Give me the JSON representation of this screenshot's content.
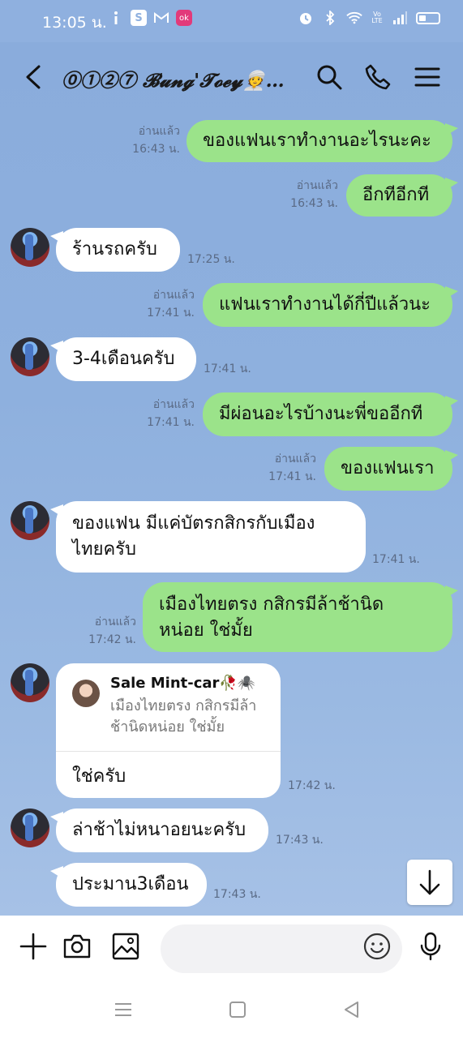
{
  "status_bar": {
    "time": "13:05 น.",
    "app_icons": [
      "info-icon",
      "s-icon",
      "gmail-icon",
      "pink-app-icon"
    ],
    "system_icons": [
      "alarm-icon",
      "bluetooth-icon",
      "wifi-icon",
      "volte-icon",
      "signal-icon",
      "battery-icon"
    ],
    "s_label": "S",
    "pink_label": "ok",
    "volte_label": "Vo LTE",
    "battery_level": 0.35
  },
  "header": {
    "title": "⓪①②⑦ 𝓑𝓾𝓷𝓰'𝓣𝓸𝓮𝔂👳…"
  },
  "messages": [
    {
      "id": "m1",
      "side": "me",
      "text": "ของแฟนเราทำงานอะไรนะคะ",
      "read": "อ่านแล้ว",
      "time": "16:43 น."
    },
    {
      "id": "m2",
      "side": "me",
      "text": "อีกทีอีกที",
      "read": "อ่านแล้ว",
      "time": "16:43 น."
    },
    {
      "id": "m3",
      "side": "them",
      "text": "ร้านรถครับ",
      "time": "17:25 น."
    },
    {
      "id": "m4",
      "side": "me",
      "text": "แฟนเราทำงานได้กี่ปีแล้วนะ",
      "read": "อ่านแล้ว",
      "time": "17:41 น."
    },
    {
      "id": "m5",
      "side": "them",
      "text": "3-4เดือนครับ",
      "time": "17:41 น."
    },
    {
      "id": "m6",
      "side": "me",
      "text": "มีผ่อนอะไรบ้างนะพี่ขออีกที",
      "read": "อ่านแล้ว",
      "time": "17:41 น."
    },
    {
      "id": "m7",
      "side": "me",
      "text": "ของแฟนเรา",
      "read": "อ่านแล้ว",
      "time": "17:41 น."
    },
    {
      "id": "m8",
      "side": "them",
      "line1": "ของแฟน มีแค่บัตรกสิกรกับเมือง",
      "line2": "ไทยครับ",
      "time": "17:41 น."
    },
    {
      "id": "m9",
      "side": "me",
      "line1": "เมืองไทยตรง กสิกรมีล้าช้านิด",
      "line2": "หน่อย ใช่มั้ย",
      "read": "อ่านแล้ว",
      "time": "17:42 น."
    },
    {
      "id": "m10",
      "side": "them",
      "reply_to_name": "Sale Mint-car🥀🕷️",
      "reply_to_line1": "เมืองไทยตรง กสิกรมีล้า",
      "reply_to_line2": "ช้านิดหน่อย ใช่มั้ย",
      "text": "ใช่ครับ",
      "time": "17:42 น."
    },
    {
      "id": "m11",
      "side": "them",
      "text": "ล่าช้าไม่หนาอยนะครับ",
      "time": "17:43 น."
    },
    {
      "id": "m12",
      "side": "them",
      "text": "ประมาน3เดือน",
      "time": "17:43 น."
    }
  ],
  "input": {
    "placeholder": ""
  }
}
